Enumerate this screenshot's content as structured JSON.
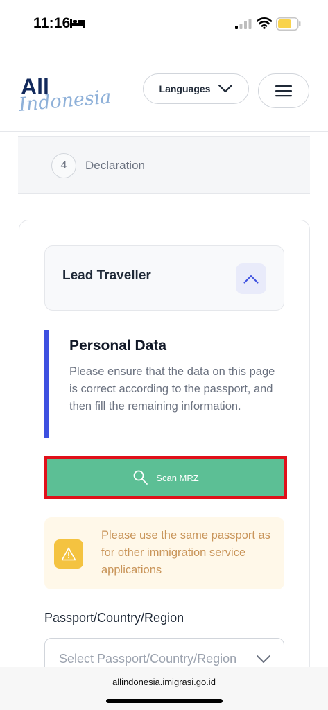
{
  "status_bar": {
    "time": "11:16",
    "sleep_icon": "bed-icon",
    "signal_icon": "cellular-signal-icon",
    "wifi_icon": "wifi-icon",
    "battery_icon": "battery-icon",
    "battery_color": "#f9d34c"
  },
  "header": {
    "logo_text_top": "All",
    "logo_text_bottom": "Indonesia.",
    "languages_label": "Languages",
    "languages_icon": "chevron-down-icon",
    "menu_icon": "hamburger-menu-icon"
  },
  "step": {
    "number": "4",
    "label": "Declaration"
  },
  "lead": {
    "title": "Lead Traveller",
    "collapse_icon": "chevron-up-icon"
  },
  "personal": {
    "title": "Personal Data",
    "description": "Please ensure that the data on this page is correct according to the passport, and then fill the remaining information."
  },
  "scan": {
    "label": "Scan MRZ",
    "icon": "search-icon"
  },
  "warning": {
    "icon": "warning-icon",
    "text": "Please use the same passport as for other immigration service applications"
  },
  "passport_field": {
    "label": "Passport/Country/Region",
    "placeholder": "Select Passport/Country/Region",
    "icon": "chevron-down-icon"
  },
  "browser": {
    "url": "allindonesia.imigrasi.go.id"
  },
  "colors": {
    "accent_blue": "#3d50e0",
    "scan_green": "#5cbf95",
    "highlight_red": "#e0101a",
    "warning_bg": "#fff8e9",
    "warning_text": "#c9955a",
    "warning_icon_bg": "#f4c340"
  }
}
